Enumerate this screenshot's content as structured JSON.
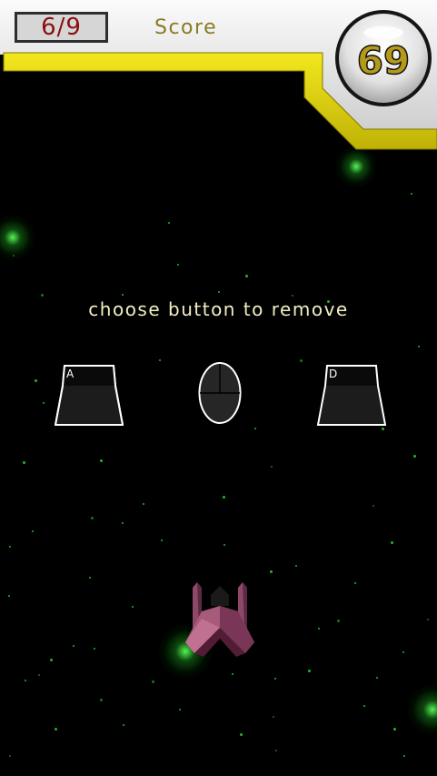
{
  "hud": {
    "progress_text": "6/9",
    "score_label": "Score",
    "score_value": "69"
  },
  "prompt": {
    "text": "choose button to remove"
  },
  "options": {
    "left_key_letter": "A",
    "right_key_letter": "D",
    "middle_icon": "mouse-icon"
  },
  "colors": {
    "hud_bar": "#e6d80a",
    "hud_panel": "#e4e4e4",
    "counter_text": "#8a0f0f",
    "score_label": "#8a7a22",
    "score_value": "#b59a1a",
    "prompt_text": "#f3efc2",
    "stars": "#2bd62b",
    "ship": "#8e3a58"
  }
}
